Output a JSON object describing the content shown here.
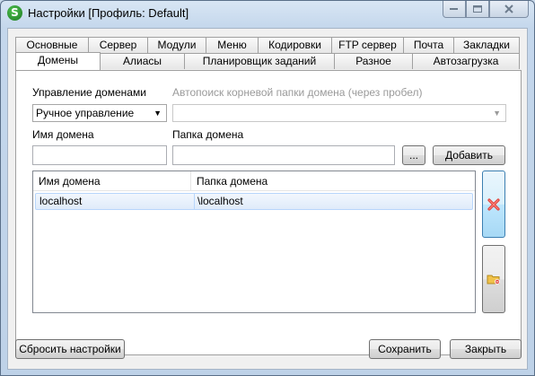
{
  "window": {
    "title": "Настройки [Профиль: Default]",
    "app_icon_letter": "S"
  },
  "tabs": {
    "row1": [
      "Основные",
      "Сервер",
      "Модули",
      "Меню",
      "Кодировки",
      "FTP сервер",
      "Почта",
      "Закладки"
    ],
    "row2": [
      "Домены",
      "Алиасы",
      "Планировщик заданий",
      "Разное",
      "Автозагрузка"
    ],
    "active": "Домены"
  },
  "domains": {
    "management_label": "Управление доменами",
    "management_value": "Ручное управление",
    "autosearch_label": "Автопоиск корневой папки домена (через пробел)",
    "autosearch_value": "",
    "name_label": "Имя домена",
    "name_value": "",
    "folder_label": "Папка домена",
    "folder_value": "",
    "browse_label": "...",
    "add_label": "Добавить",
    "table": {
      "columns": [
        "Имя домена",
        "Папка домена"
      ],
      "rows": [
        {
          "name": "localhost",
          "folder": "\\localhost"
        }
      ]
    }
  },
  "footer": {
    "reset_label": "Сбросить настройки",
    "save_label": "Сохранить",
    "close_label": "Закрыть"
  },
  "colors": {
    "delete_icon": "#e0403a",
    "folder_icon": "#f0c24a"
  }
}
